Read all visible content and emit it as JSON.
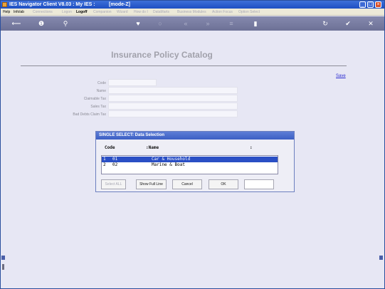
{
  "window": {
    "title": "IES Navigator Client V8.03 : My IES :          [mode-Z]"
  },
  "menu": [
    {
      "label": "Help",
      "state": "enabled"
    },
    {
      "label": "Infolab",
      "state": "enabled"
    },
    {
      "label": "Connections",
      "state": "disabled"
    },
    {
      "label": "Logon",
      "state": "disabled"
    },
    {
      "label": "Logoff",
      "state": "bold"
    },
    {
      "label": "Companion",
      "state": "disabled"
    },
    {
      "label": "Wizard",
      "state": "disabled"
    },
    {
      "label": "How do I",
      "state": "disabled"
    },
    {
      "label": "DataMarts",
      "state": "disabled"
    },
    {
      "label": "Business Modules",
      "state": "disabled"
    },
    {
      "label": "Action Focus",
      "state": "disabled"
    },
    {
      "label": "Option Select",
      "state": "disabled"
    }
  ],
  "toolbar_icons": [
    "back-icon",
    "info-icon",
    "search-icon",
    "heart-icon",
    "circle-icon",
    "rewind-icon",
    "forward-icon",
    "list-icon",
    "document-icon",
    "refresh-icon",
    "check-icon",
    "close-icon"
  ],
  "page": {
    "title": "Insurance Policy Catalog",
    "save_label": "Save",
    "fields": [
      {
        "label": "Code",
        "value": ""
      },
      {
        "label": "Name",
        "value": ""
      },
      {
        "label": "Claimable Tax",
        "value": ""
      },
      {
        "label": "Sales Tax",
        "value": ""
      },
      {
        "label": "Bad Debts Claim Tax",
        "value": ""
      }
    ]
  },
  "dialog": {
    "title": "SINGLE SELECT: Data Selection",
    "columns": [
      "Code",
      ":Name",
      ":"
    ],
    "rows": [
      {
        "num": "1",
        "code": "01",
        "name": "Car & Household",
        "selected": true
      },
      {
        "num": "2",
        "code": "02",
        "name": "Marine & Boat",
        "selected": false
      }
    ],
    "buttons": {
      "select_all": "Select ALL",
      "show_full_line": "Show Full Line",
      "cancel": "Cancel",
      "ok": "OK"
    },
    "input_value": ""
  },
  "colors": {
    "titlebar": "#1e4fc2",
    "toolbar": "#6d7196",
    "background": "#e7e7f4",
    "selection": "#2a4fc5",
    "link": "#2a2ad0"
  }
}
